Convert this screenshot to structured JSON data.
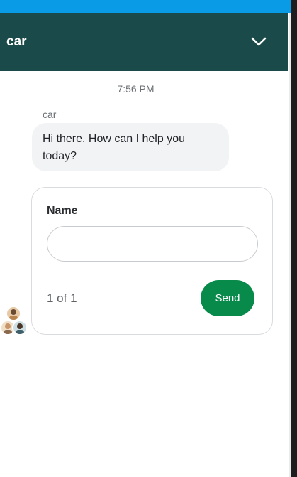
{
  "header": {
    "title": "car",
    "collapse_icon": "chevron-down-icon"
  },
  "conversation": {
    "timestamp": "7:56 PM",
    "sender": "car",
    "message": "Hi there. How can I help you today?"
  },
  "form": {
    "field_label": "Name",
    "field_value": "",
    "pager": "1 of 1",
    "send_label": "Send"
  },
  "colors": {
    "top_strip": "#0a9be6",
    "header_bg": "#1b4a4a",
    "send_button": "#078a4a",
    "bubble_bg": "#f2f3f5"
  }
}
